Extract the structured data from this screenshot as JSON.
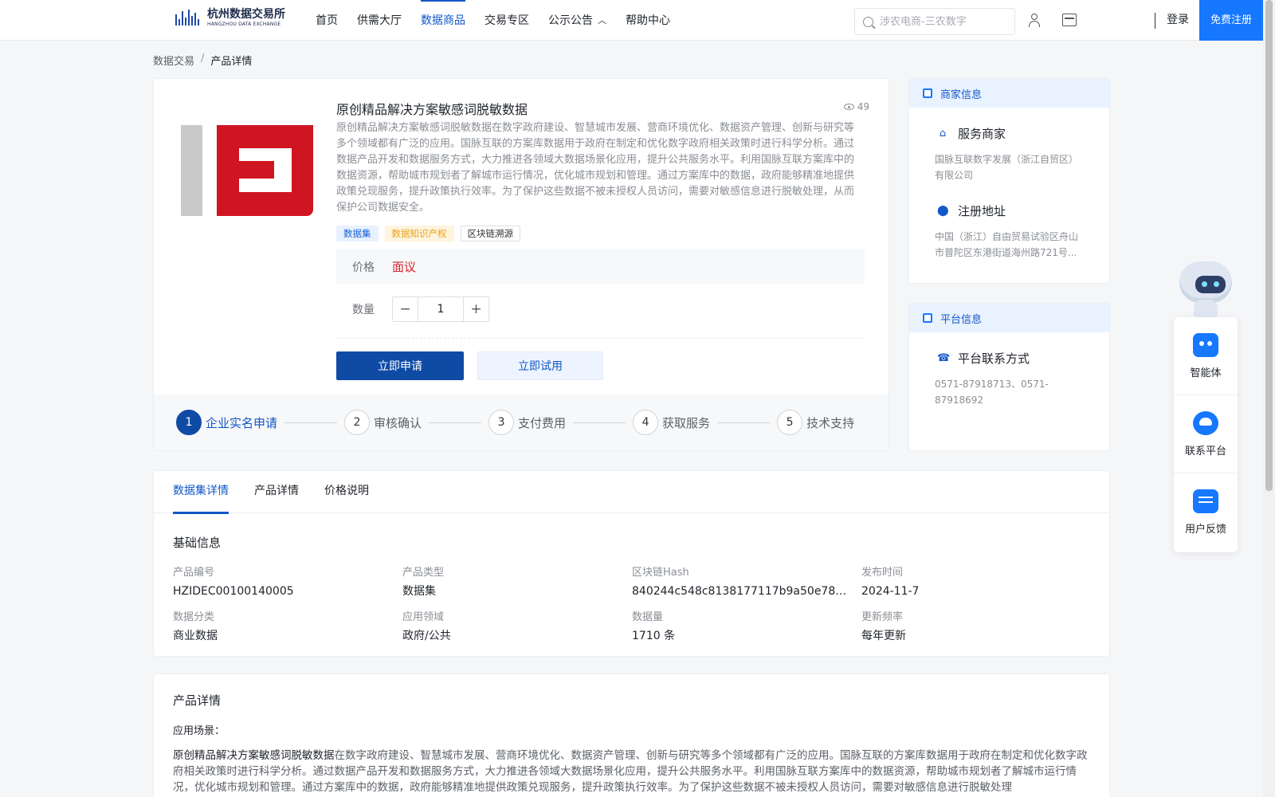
{
  "header": {
    "logo_cn": "杭州数据交易所",
    "logo_en": "HANGZHOU DATA EXCHANGE",
    "nav": [
      "首页",
      "供需大厅",
      "数据商品",
      "交易专区",
      "公示公告",
      "帮助中心"
    ],
    "active_nav": "数据商品",
    "search_placeholder": "涉农电商-三农数字",
    "login": "登录",
    "register": "免费注册"
  },
  "breadcrumb": {
    "root": "数据交易",
    "sep": "/",
    "current": "产品详情"
  },
  "product": {
    "title": "原创精品解决方案敏感词脱敏数据",
    "views": "49",
    "description": "原创精品解决方案敏感词脱敏数据在数字政府建设、智慧城市发展、营商环境优化、数据资产管理、创新与研究等多个领域都有广泛的应用。国脉互联的方案库数据用于政府在制定和优化数字政府相关政策时进行科学分析。通过数据产品开发和数据服务方式，大力推进各领域大数据场景化应用，提升公共服务水平。利用国脉互联方案库中的数据资源，帮助城市规划者了解城市运行情况，优化城市规划和管理。通过方案库中的数据，政府能够精准地提供政策兑现服务，提升政策执行效率。为了保护这些数据不被未授权人员访问，需要对敏感信息进行脱敏处理，从而保护公司数据安全。",
    "tags": [
      "数据集",
      "数据知识产权",
      "区块链溯源"
    ],
    "price_label": "价格",
    "price_value": "面议",
    "qty_label": "数量",
    "qty_value": "1",
    "apply_btn": "立即申请",
    "try_btn": "立即试用",
    "steps": [
      {
        "num": "1",
        "label": "企业实名申请"
      },
      {
        "num": "2",
        "label": "审核确认"
      },
      {
        "num": "3",
        "label": "支付费用"
      },
      {
        "num": "4",
        "label": "获取服务"
      },
      {
        "num": "5",
        "label": "技术支持"
      }
    ]
  },
  "merchant": {
    "header": "商家信息",
    "service_title": "服务商家",
    "service_value": "国脉互联数字发展（浙江自贸区）有限公司",
    "address_title": "注册地址",
    "address_value": "中国（浙江）自由贸易试验区舟山市普陀区东港街道海州路721号..."
  },
  "platform": {
    "header": "平台信息",
    "contact_title": "平台联系方式",
    "contact_value": "0571-87918713、0571-87918692"
  },
  "float_panel": [
    "智能体",
    "联系平台",
    "用户反馈"
  ],
  "tabs": [
    "数据集详情",
    "产品详情",
    "价格说明"
  ],
  "basic_info": {
    "title": "基础信息",
    "fields": [
      {
        "label": "产品编号",
        "value": "HZIDEC00100140005"
      },
      {
        "label": "产品类型",
        "value": "数据集"
      },
      {
        "label": "区块链Hash",
        "value": "840244c548c8138177117b9a50e78364527..."
      },
      {
        "label": "发布时间",
        "value": "2024-11-7"
      },
      {
        "label": "数据分类",
        "value": "商业数据"
      },
      {
        "label": "应用领域",
        "value": "政府/公共"
      },
      {
        "label": "数据量",
        "value": "1710 条"
      },
      {
        "label": "更新频率",
        "value": "每年更新"
      }
    ]
  },
  "detail": {
    "title": "产品详情",
    "subtitle": "应用场景：",
    "lead": "原创精品解决方案敏感词脱敏数据",
    "text": "在数字政府建设、智慧城市发展、营商环境优化、数据资产管理、创新与研究等多个领域都有广泛的应用。国脉互联的方案库数据用于政府在制定和优化数字政府相关政策时进行科学分析。通过数据产品开发和数据服务方式，大力推进各领域大数据场景化应用，提升公共服务水平。利用国脉互联方案库中的数据资源，帮助城市规划者了解城市运行情况，优化城市规划和管理。通过方案库中的数据，政府能够精准地提供政策兑现服务，提升政策执行效率。为了保护这些数据不被未授权人员访问，需要对敏感信息进行脱敏处理"
  },
  "colors": {
    "primary": "#0f4ba5",
    "accent": "#1677ff",
    "price": "#d4242b"
  }
}
